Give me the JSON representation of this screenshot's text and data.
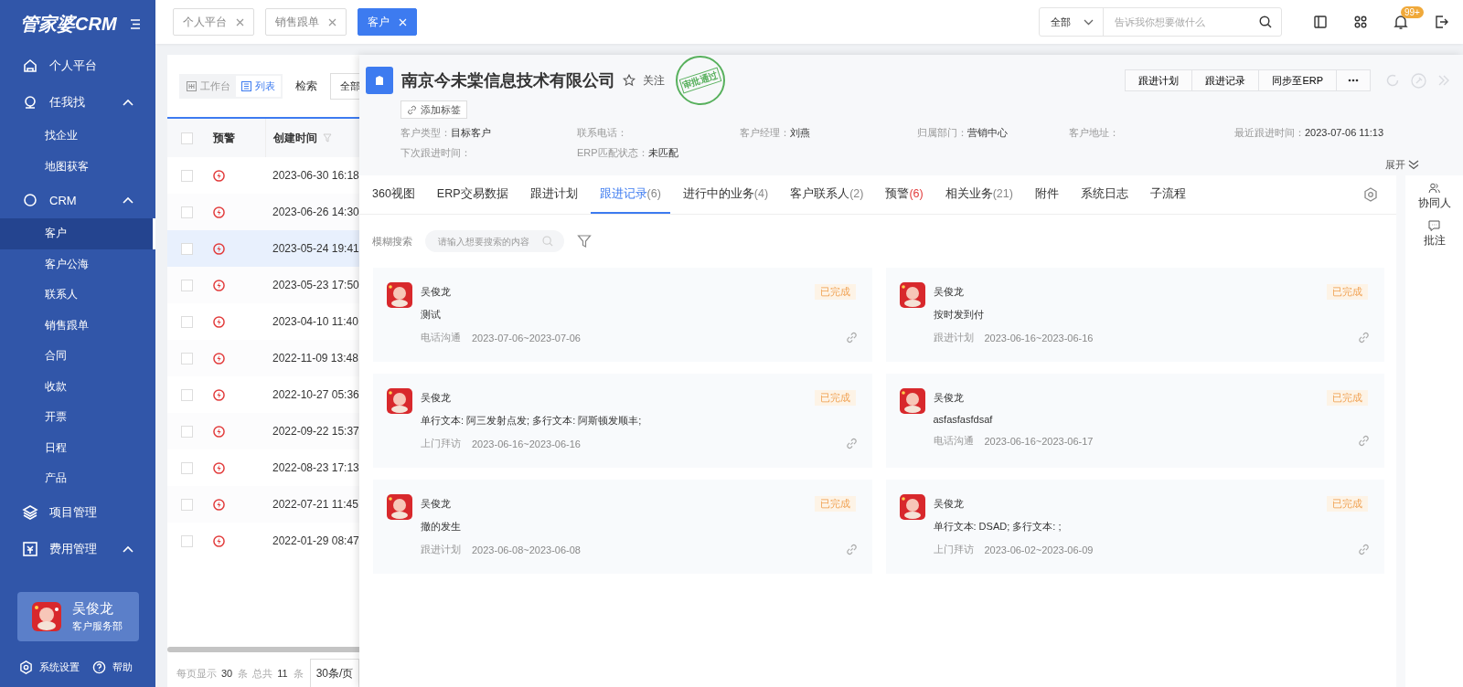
{
  "sidebar": {
    "logo": "管家婆CRM",
    "menu": [
      {
        "label": "个人平台",
        "selected": false
      },
      {
        "label": "任我找",
        "selected": false,
        "expanded": true,
        "children": [
          {
            "label": "找企业",
            "selected": false
          },
          {
            "label": "地图获客",
            "selected": false
          }
        ]
      },
      {
        "label": "CRM",
        "selected": false,
        "expanded": true,
        "children": [
          {
            "label": "客户",
            "selected": true
          },
          {
            "label": "客户公海",
            "selected": false
          },
          {
            "label": "联系人",
            "selected": false
          },
          {
            "label": "销售跟单",
            "selected": false
          },
          {
            "label": "合同",
            "selected": false
          },
          {
            "label": "收款",
            "selected": false
          },
          {
            "label": "开票",
            "selected": false
          },
          {
            "label": "日程",
            "selected": false
          },
          {
            "label": "产品",
            "selected": false
          }
        ]
      },
      {
        "label": "项目管理",
        "selected": false
      },
      {
        "label": "费用管理",
        "selected": false,
        "expanded": true
      }
    ],
    "user": {
      "name": "吴俊龙",
      "dept": "客户服务部"
    },
    "footer": [
      "系统设置",
      "帮助"
    ]
  },
  "top_bar": {
    "tabs": [
      {
        "label": "个人平台",
        "selected": false
      },
      {
        "label": "销售跟单",
        "selected": false
      },
      {
        "label": "客户",
        "selected": true
      }
    ],
    "scope": "全部",
    "search": {
      "placeholder": "告诉我你想要做什么"
    },
    "badge": "99+"
  },
  "list": {
    "views": [
      {
        "label": "工作台",
        "selected": false
      },
      {
        "label": "列表",
        "selected": true
      }
    ],
    "all_checked": false,
    "search_label": "检索",
    "filter": "全部",
    "columns": [
      "预警",
      "创建时间"
    ],
    "rows": [
      {
        "created": "2023-06-30 16:18",
        "selected": false,
        "checked": false
      },
      {
        "created": "2023-06-26 14:30",
        "selected": false,
        "checked": false
      },
      {
        "created": "2023-05-24 19:41",
        "selected": true,
        "checked": false
      },
      {
        "created": "2023-05-23 17:50",
        "selected": false,
        "checked": false
      },
      {
        "created": "2023-04-10 11:40",
        "selected": false,
        "checked": false
      },
      {
        "created": "2022-11-09 13:48",
        "selected": false,
        "checked": false
      },
      {
        "created": "2022-10-27 05:36",
        "selected": false,
        "checked": false
      },
      {
        "created": "2022-09-22 15:37",
        "selected": false,
        "checked": false
      },
      {
        "created": "2022-08-23 17:13",
        "selected": false,
        "checked": false
      },
      {
        "created": "2022-07-21 11:45",
        "selected": false,
        "checked": false
      },
      {
        "created": "2022-01-29 08:47",
        "selected": false,
        "checked": false
      }
    ],
    "pagination": {
      "per_page_label": "每页显示",
      "per_page": "30",
      "per_page_unit": "条",
      "total_label": "总共",
      "total": "11",
      "total_unit": "条",
      "page_size": "30条/页"
    }
  },
  "detail": {
    "title": "南京今未棠信息技术有限公司",
    "followed": false,
    "follow_label": "关注",
    "stamp": "审批通过",
    "tag_button": "添加标签",
    "actions": [
      "跟进计划",
      "跟进记录",
      "同步至ERP"
    ],
    "fields": [
      {
        "label": "客户类型：",
        "value": "目标客户"
      },
      {
        "label": "联系电话："
      },
      {
        "label": "客户经理：",
        "value": "刘燕"
      },
      {
        "label": "归属部门：",
        "value": "营销中心"
      },
      {
        "label": "客户地址："
      },
      {
        "label": "最近跟进时间：",
        "value": "2023-07-06 11:13"
      },
      {
        "label": "下次跟进时间："
      },
      {
        "label": "ERP匹配状态：",
        "value": "未匹配"
      }
    ],
    "expand": "展开",
    "tabs": [
      {
        "label": "360视图",
        "selected": false
      },
      {
        "label": "ERP交易数据",
        "selected": false
      },
      {
        "label": "跟进计划",
        "selected": false
      },
      {
        "label": "跟进记录",
        "count": "(6)",
        "alert": false,
        "selected": true
      },
      {
        "label": "进行中的业务",
        "count": "(4)",
        "alert": false,
        "selected": false
      },
      {
        "label": "客户联系人",
        "count": "(2)",
        "alert": false,
        "selected": false
      },
      {
        "label": "预警",
        "count": "(6)",
        "alert": true,
        "selected": false
      },
      {
        "label": "相关业务",
        "count": "(21)",
        "alert": false,
        "selected": false
      },
      {
        "label": "附件",
        "selected": false
      },
      {
        "label": "系统日志",
        "selected": false
      },
      {
        "label": "子流程",
        "selected": false
      }
    ],
    "search_label": "模糊搜索",
    "search": {
      "placeholder": "请输入想要搜索的内容"
    },
    "records": [
      {
        "author": "吴俊龙",
        "status": "已完成",
        "content": "测试",
        "type": "电话沟通",
        "range": "2023-07-06~2023-07-06"
      },
      {
        "author": "吴俊龙",
        "status": "已完成",
        "content": "按时发到付",
        "type": "跟进计划",
        "range": "2023-06-16~2023-06-16"
      },
      {
        "author": "吴俊龙",
        "status": "已完成",
        "content": "单行文本: 阿三发射点发; 多行文本: 阿斯顿发顺丰;",
        "type": "上门拜访",
        "range": "2023-06-16~2023-06-16"
      },
      {
        "author": "吴俊龙",
        "status": "已完成",
        "content": "asfasfasfdsaf",
        "type": "电话沟通",
        "range": "2023-06-16~2023-06-17"
      },
      {
        "author": "吴俊龙",
        "status": "已完成",
        "content": "撤的发生",
        "type": "跟进计划",
        "range": "2023-06-08~2023-06-08"
      },
      {
        "author": "吴俊龙",
        "status": "已完成",
        "content": "单行文本: DSAD; 多行文本: ;",
        "type": "上门拜访",
        "range": "2023-06-02~2023-06-09"
      }
    ],
    "side": [
      "协同人",
      "批注"
    ]
  }
}
